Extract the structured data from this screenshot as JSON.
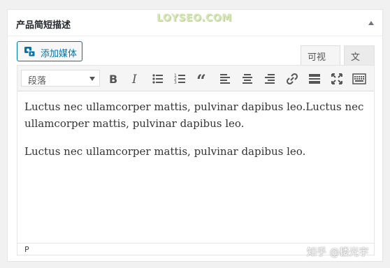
{
  "metabox": {
    "title": "产品简短描述",
    "watermark": "LOYSEO.COM"
  },
  "toolbar_top": {
    "add_media_label": "添加媒体",
    "tab_visual": "可视化",
    "tab_text": "文本"
  },
  "editor": {
    "format_select_value": "段落",
    "paragraphs": [
      "Luctus nec ullamcorper mattis, pulvinar dapibus leo.Luctus nec ullamcorper mattis, pulvinar dapibus leo.",
      "Luctus nec ullamcorper mattis, pulvinar dapibus leo."
    ],
    "statusbar_path": "P"
  },
  "overlay": {
    "zh_watermark": "知乎 @楼光宇"
  },
  "icons": [
    "bold-icon",
    "italic-icon",
    "bullet-list-icon",
    "numbered-list-icon",
    "blockquote-icon",
    "align-left-icon",
    "align-center-icon",
    "align-right-icon",
    "link-icon",
    "read-more-icon",
    "fullscreen-icon",
    "toolbar-toggle-icon",
    "add-media-icon"
  ],
  "colors": {
    "accent": "#0073aa",
    "panel_bg": "#ffffff",
    "page_bg": "#f1f1f1",
    "toolbar_bg": "#f5f5f5"
  }
}
